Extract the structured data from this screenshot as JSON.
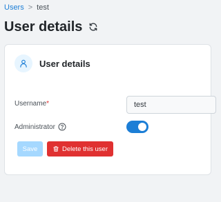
{
  "breadcrumb": {
    "root": "Users",
    "separator": ">",
    "current": "test"
  },
  "header": {
    "title": "User details",
    "refresh_icon": "refresh-icon"
  },
  "card": {
    "icon": "user-icon",
    "title": "User details",
    "username": {
      "label": "Username",
      "required_mark": "*",
      "value": "test"
    },
    "administrator": {
      "label": "Administrator",
      "help_icon": "help-circle-icon",
      "enabled": true
    },
    "actions": {
      "save_label": "Save",
      "delete_label": "Delete this user",
      "delete_icon": "trash-icon"
    }
  },
  "colors": {
    "accent": "#1c7ed6",
    "danger": "#e03131",
    "disabled_primary": "#a5d8ff"
  }
}
